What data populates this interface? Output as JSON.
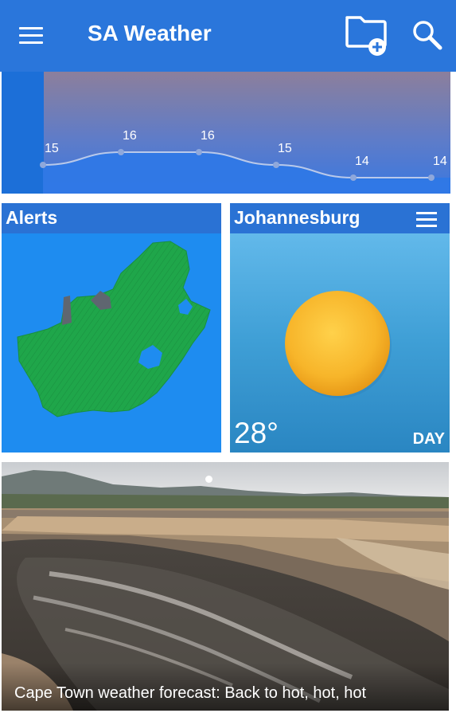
{
  "app": {
    "title": "SA Weather",
    "accent_color": "#2a76db"
  },
  "toolbar": {
    "menu_icon": "hamburger-menu-icon",
    "add_location_icon": "folder-add-icon",
    "search_icon": "search-icon"
  },
  "forecast_chart": {
    "temperature_labels": [
      "15",
      "16",
      "16",
      "15",
      "14",
      "14"
    ]
  },
  "chart_data": {
    "type": "area",
    "title": "",
    "xlabel": "",
    "ylabel": "",
    "values": [
      15,
      16,
      16,
      15,
      14,
      14
    ],
    "ylim": [
      14,
      16
    ],
    "grid": false
  },
  "alerts_card": {
    "title": "Alerts",
    "map_fill_color": "#1fa64a"
  },
  "city_card": {
    "city": "Johannesburg",
    "temperature": "28°",
    "period": "DAY",
    "condition_icon": "sun-icon"
  },
  "news": {
    "headline": "Cape Town weather forecast: Back to hot, hot, hot"
  }
}
